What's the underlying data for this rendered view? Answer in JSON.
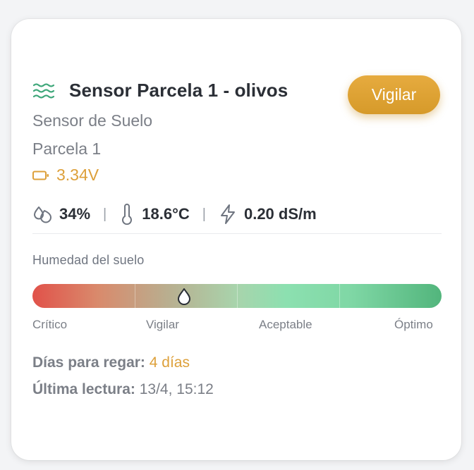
{
  "card": {
    "title": "Sensor Parcela 1 - olivos",
    "sensor_type": "Sensor de Suelo",
    "parcel": "Parcela 1",
    "battery": "3.34V",
    "watch_button": "Vigilar"
  },
  "metrics": {
    "humidity": "34%",
    "temperature": "18.6°C",
    "conductivity": "0.20 dS/m",
    "separator": "|"
  },
  "moisture": {
    "label": "Humedad del suelo",
    "level_percent": 37,
    "scale": [
      "Crítico",
      "Vigilar",
      "Aceptable",
      "Óptimo"
    ]
  },
  "irrigation": {
    "days_label": "Días para regar:",
    "days_value": "4 días",
    "last_label": "Última lectura:",
    "last_value": "13/4, 15:12"
  },
  "icons": {
    "header": "waves-icon",
    "battery": "battery-icon",
    "humidity": "droplets-icon",
    "temperature": "thermometer-icon",
    "conductivity": "lightning-icon",
    "marker": "droplet-icon"
  },
  "colors": {
    "accent": "#dda03a",
    "button": "#dea03a",
    "wave": "#3fa77a",
    "text": "#2b2f36",
    "muted": "#7b7f87"
  }
}
